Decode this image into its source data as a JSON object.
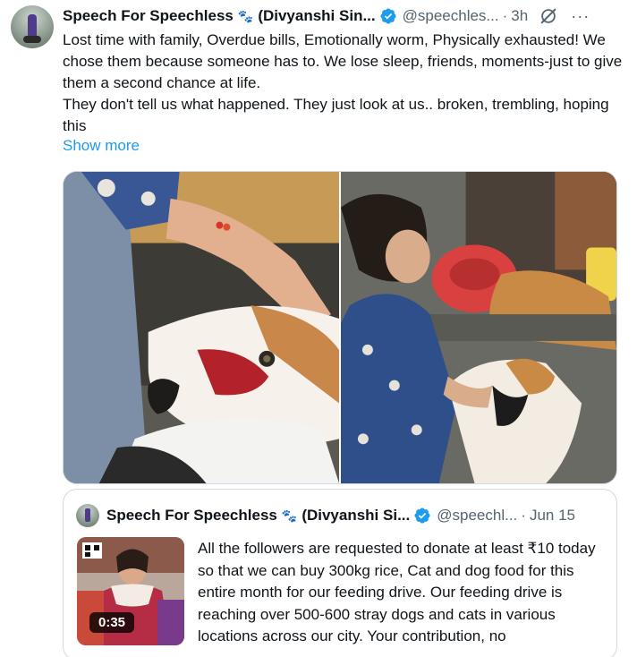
{
  "tweet": {
    "author_name": "Speech For Speechless",
    "author_name_suffix": "(Divyanshi Sin...",
    "paw_icon": "paw-prints-icon",
    "verified": true,
    "handle": "@speechles...",
    "separator": "·",
    "time": "3h",
    "more_label": "···",
    "body_lines": [
      "Lost time with family, Overdue bills, Emotionally worm, Physically exhausted! We chose them because someone has to. We lose sleep, friends, moments-just to give them a second chance at life.",
      "They don't tell us what happened. They just look at us.. broken, trembling, hoping this"
    ],
    "show_more": "Show more",
    "media": [
      {
        "icon": "injured-dog-photo",
        "description_only": true
      },
      {
        "icon": "woman-with-dogs-photo",
        "description_only": true
      }
    ]
  },
  "quoted": {
    "author_name": "Speech For Speechless",
    "author_name_suffix": "(Divyanshi Si...",
    "verified": true,
    "handle": "@speechl...",
    "separator": "·",
    "date": "Jun 15",
    "video_duration": "0:35",
    "body": "All the followers are requested to donate at least ₹10 today so that we can buy 300kg rice, Cat and dog food for this entire month for our feeding drive. Our feeding drive is reaching over 500-600 stray dogs and cats in various locations across our city. Your contribution, no"
  },
  "colors": {
    "link": "#1d9bf0",
    "verified": "#1d9bf0",
    "secondary_text": "#536471",
    "border": "#cfd9de"
  }
}
